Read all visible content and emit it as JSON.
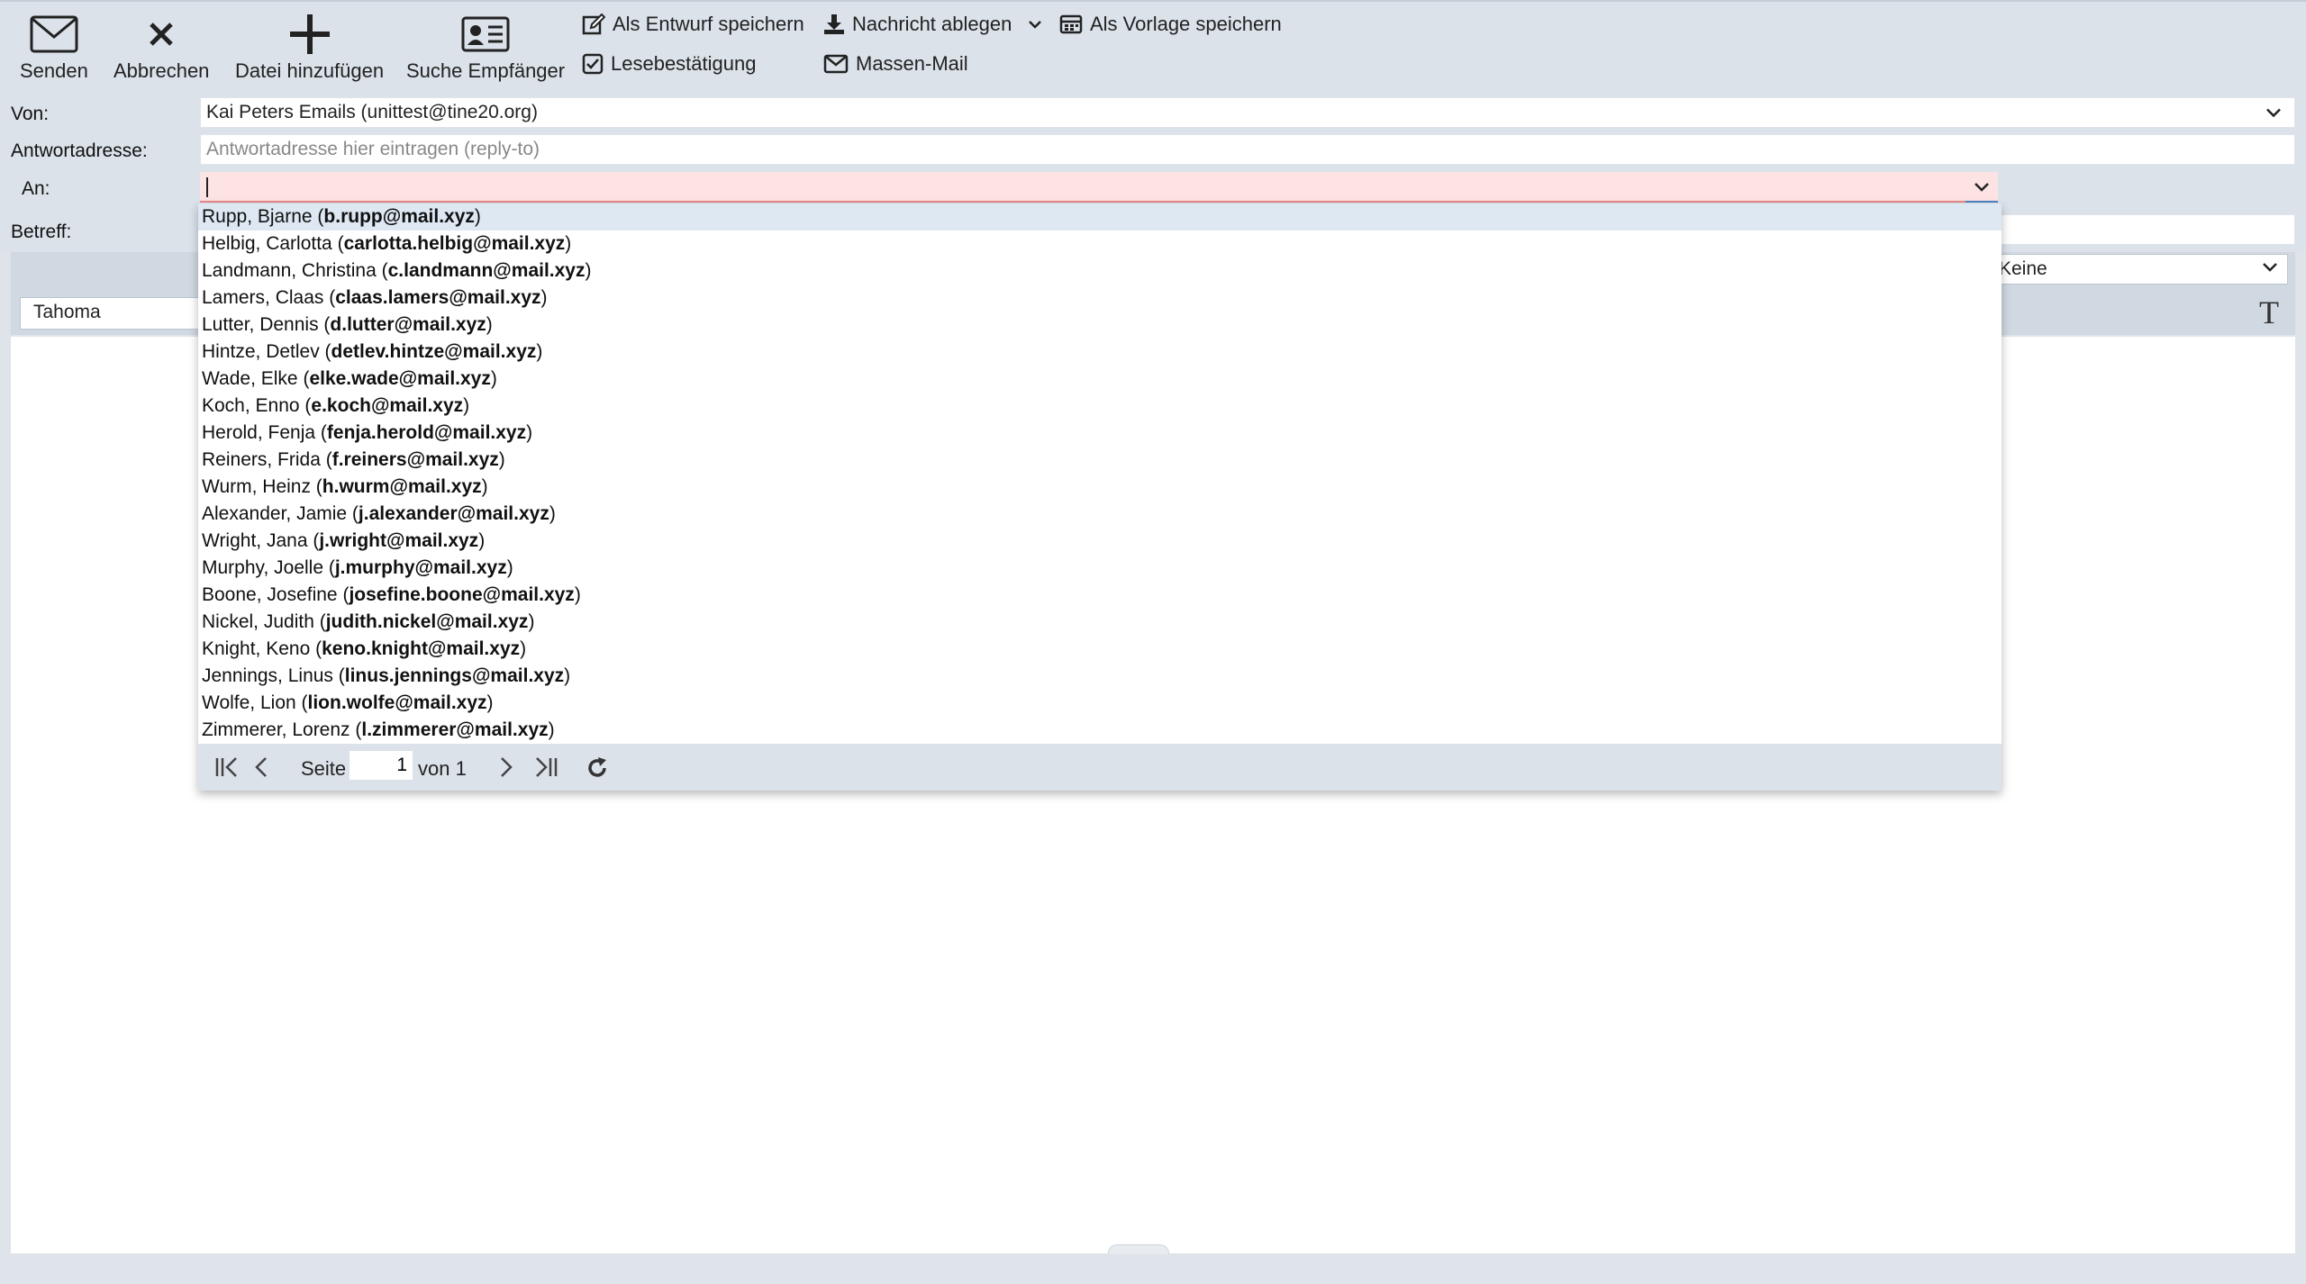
{
  "toolbar": {
    "send": "Senden",
    "cancel": "Abbrechen",
    "add_file": "Datei hinzufügen",
    "search_recipients": "Suche Empfänger",
    "save_draft": "Als Entwurf speichern",
    "file_message": "Nachricht ablegen",
    "save_template": "Als Vorlage speichern",
    "read_receipt": "Lesebestätigung",
    "mass_mail": "Massen-Mail"
  },
  "form": {
    "from_label": "Von:",
    "from_value": "Kai Peters Emails (unittest@tine20.org)",
    "reply_to_label": "Antwortadresse:",
    "reply_to_placeholder": "Antwortadresse hier eintragen (reply-to)",
    "to_label": "An:",
    "to_value": "",
    "subject_label": "Betreff:"
  },
  "editor": {
    "font": "Tahoma",
    "select_value": "Keine",
    "format_icon": "T"
  },
  "dropdown": {
    "items": [
      {
        "name": "Rupp, Bjarne",
        "email": "b.rupp@mail.xyz"
      },
      {
        "name": "Helbig, Carlotta",
        "email": "carlotta.helbig@mail.xyz"
      },
      {
        "name": "Landmann, Christina",
        "email": "c.landmann@mail.xyz"
      },
      {
        "name": "Lamers, Claas",
        "email": "claas.lamers@mail.xyz"
      },
      {
        "name": "Lutter, Dennis",
        "email": "d.lutter@mail.xyz"
      },
      {
        "name": "Hintze, Detlev",
        "email": "detlev.hintze@mail.xyz"
      },
      {
        "name": "Wade, Elke",
        "email": "elke.wade@mail.xyz"
      },
      {
        "name": "Koch, Enno",
        "email": "e.koch@mail.xyz"
      },
      {
        "name": "Herold, Fenja",
        "email": "fenja.herold@mail.xyz"
      },
      {
        "name": "Reiners, Frida",
        "email": "f.reiners@mail.xyz"
      },
      {
        "name": "Wurm, Heinz",
        "email": "h.wurm@mail.xyz"
      },
      {
        "name": "Alexander, Jamie",
        "email": "j.alexander@mail.xyz"
      },
      {
        "name": "Wright, Jana",
        "email": "j.wright@mail.xyz"
      },
      {
        "name": "Murphy, Joelle",
        "email": "j.murphy@mail.xyz"
      },
      {
        "name": "Boone, Josefine",
        "email": "josefine.boone@mail.xyz"
      },
      {
        "name": "Nickel, Judith",
        "email": "judith.nickel@mail.xyz"
      },
      {
        "name": "Knight, Keno",
        "email": "keno.knight@mail.xyz"
      },
      {
        "name": "Jennings, Linus",
        "email": "linus.jennings@mail.xyz"
      },
      {
        "name": "Wolfe, Lion",
        "email": "lion.wolfe@mail.xyz"
      },
      {
        "name": "Zimmerer, Lorenz",
        "email": "l.zimmerer@mail.xyz"
      }
    ],
    "pager": {
      "page_label": "Seite",
      "page_value": "1",
      "of_label": "von 1"
    }
  }
}
